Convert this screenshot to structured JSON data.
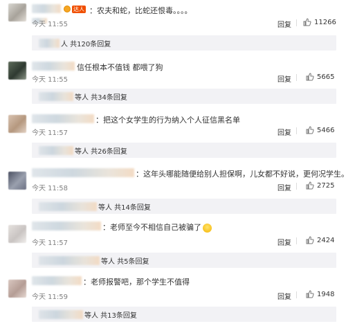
{
  "comments": [
    {
      "badge": "达人",
      "text": "：农夫和蛇，比蛇还恨毒。。。。",
      "time": "今天 11:55",
      "reply_label": "回复",
      "likes": "11266",
      "sub_suffix": "人 共120条回复"
    },
    {
      "text": "信任根本不值钱 都喂了狗",
      "time": "今天 11:55",
      "reply_label": "回复",
      "likes": "5665",
      "sub_suffix": "等人 共34条回复"
    },
    {
      "text": "：把这个女学生的行为纳入个人征信黑名单",
      "time": "今天 11:57",
      "reply_label": "回复",
      "likes": "5466",
      "sub_suffix": "等人 共26条回复"
    },
    {
      "text": "：这年头哪能随便给别人担保啊，儿女都不好说，更何况学生。",
      "time": "今天 11:58",
      "reply_label": "回复",
      "likes": "2725",
      "sub_suffix": "等人 共14条回复"
    },
    {
      "text": "：老师至今不相信自己被骗了",
      "time": "今天 11:57",
      "reply_label": "回复",
      "likes": "2424",
      "sub_suffix": "等人 共5条回复"
    },
    {
      "text": "：老师报警吧，那个学生不值得",
      "time": "今天 11:59",
      "reply_label": "回复",
      "likes": "1948",
      "sub_suffix": "等人 共13条回复"
    }
  ]
}
